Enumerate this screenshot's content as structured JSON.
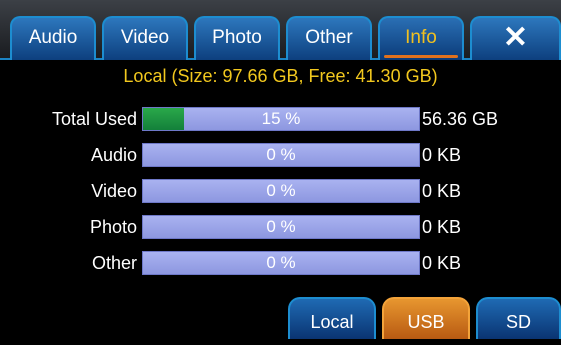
{
  "tabs": [
    {
      "label": "Audio"
    },
    {
      "label": "Video"
    },
    {
      "label": "Photo"
    },
    {
      "label": "Other"
    },
    {
      "label": "Info"
    }
  ],
  "active_tab": "Info",
  "close_symbol": "✕",
  "storage_title": "Local (Size: 97.66 GB, Free: 41.30 GB)",
  "rows": [
    {
      "label": "Total Used",
      "percent_text": "15 %",
      "fraction": 0.15,
      "size": "56.36 GB"
    },
    {
      "label": "Audio",
      "percent_text": "0 %",
      "fraction": 0,
      "size": "0 KB"
    },
    {
      "label": "Video",
      "percent_text": "0 %",
      "fraction": 0,
      "size": "0 KB"
    },
    {
      "label": "Photo",
      "percent_text": "0 %",
      "fraction": 0,
      "size": "0 KB"
    },
    {
      "label": "Other",
      "percent_text": "0 %",
      "fraction": 0,
      "size": "0 KB"
    }
  ],
  "sources": [
    {
      "label": "Local"
    },
    {
      "label": "USB"
    },
    {
      "label": "SD"
    }
  ],
  "active_source": "USB",
  "colors": {
    "accent_blue": "#1d8dd0",
    "title_yellow": "#f2c81e",
    "used_green": "#2aa84a",
    "bar_lavender": "#a9b2f0",
    "active_orange": "#e7962f"
  }
}
